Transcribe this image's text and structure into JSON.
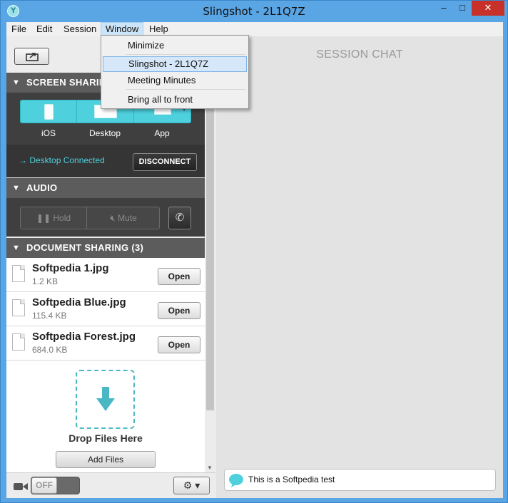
{
  "window": {
    "title": "Slingshot - 2L1Q7Z",
    "app_icon": "slingshot-logo",
    "min_glyph": "–",
    "max_glyph": "□",
    "close_glyph": "✕"
  },
  "menubar": {
    "items": [
      "File",
      "Edit",
      "Session",
      "Window",
      "Help"
    ]
  },
  "window_menu": {
    "items": [
      "Minimize",
      "Slingshot - 2L1Q7Z",
      "Meeting Minutes",
      "Bring all to front"
    ],
    "selected": "Slingshot - 2L1Q7Z"
  },
  "screen_sharing": {
    "header": "SCREEN SHARING",
    "options": [
      "iOS",
      "Desktop",
      "App"
    ],
    "status": "Desktop Connected",
    "status_arrow": "→",
    "disconnect_label": "DISCONNECT"
  },
  "audio": {
    "header": "AUDIO",
    "hold_label": "Hold",
    "mute_label": "Mute"
  },
  "document_sharing": {
    "header": "DOCUMENT SHARING (3)",
    "documents": [
      {
        "name": "Softpedia 1.jpg",
        "size": "1.2 KB",
        "action": "Open"
      },
      {
        "name": "Softpedia Blue.jpg",
        "size": "115.4 KB",
        "action": "Open"
      },
      {
        "name": "Softpedia Forest.jpg",
        "size": "684.0 KB",
        "action": "Open"
      }
    ],
    "drop_label": "Drop Files Here",
    "add_files_label": "Add Files"
  },
  "bottom_bar": {
    "camera_toggle": "OFF",
    "settings_caret": "▾"
  },
  "chat": {
    "title": "SESSION CHAT",
    "message": "This is a Softpedia test"
  },
  "colors": {
    "accent": "#4ed0dd",
    "titlebar": "#5aa5e4",
    "section_header": "#5c5c5c",
    "close_button": "#c7312a"
  }
}
